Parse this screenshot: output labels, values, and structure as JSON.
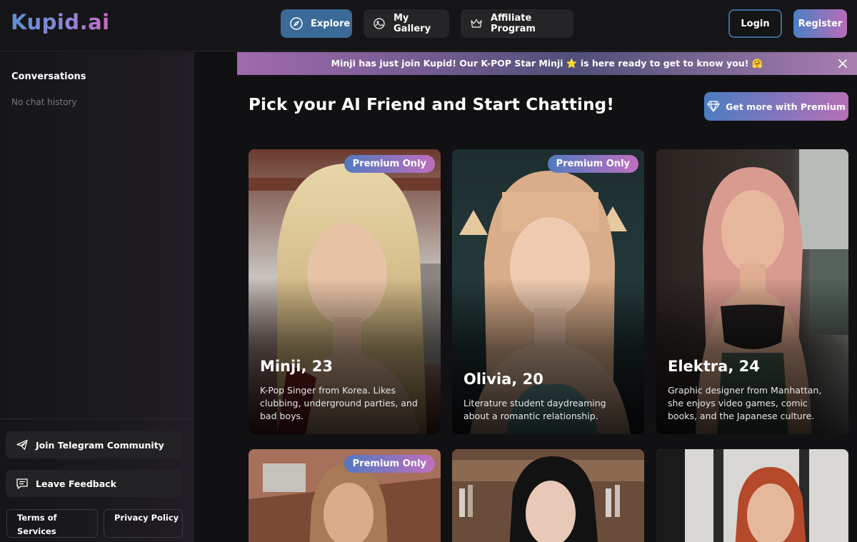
{
  "header": {
    "logo": "Kupid.ai",
    "nav": [
      {
        "label": "Explore",
        "icon": "compass-icon",
        "active": true
      },
      {
        "label": "My Gallery",
        "icon": "gallery-icon",
        "active": false
      },
      {
        "label": "Affiliate Program",
        "icon": "crown-icon",
        "active": false
      }
    ],
    "login_label": "Login",
    "register_label": "Register"
  },
  "sidebar": {
    "conversations_title": "Conversations",
    "empty_text": "No chat history",
    "telegram_label": "Join Telegram Community",
    "feedback_label": "Leave Feedback",
    "terms_label": "Terms of Services",
    "privacy_label": "Privacy Policy"
  },
  "announcement": {
    "text": "Minji has just join Kupid! Our K-POP Star Minji ⭐ is here ready to get to know you! 🤗"
  },
  "main": {
    "heading": "Pick your AI Friend and Start Chatting!",
    "premium_button": "Get more with Premium",
    "cards": [
      {
        "name": "Minji, 23",
        "description": "K-Pop Singer from Korea. Likes clubbing, underground parties, and bad boys.",
        "badge": "Premium Only"
      },
      {
        "name": "Olivia, 20",
        "description": "Literature student daydreaming about a romantic relationship.",
        "badge": "Premium Only"
      },
      {
        "name": "Elektra, 24",
        "description": "Graphic designer from Manhattan, she enjoys video games, comic books, and the Japanese culture.",
        "badge": ""
      },
      {
        "name": "",
        "description": "",
        "badge": "Premium Only"
      },
      {
        "name": "",
        "description": "",
        "badge": ""
      },
      {
        "name": "",
        "description": "",
        "badge": ""
      }
    ]
  },
  "colors": {
    "background": "#111113",
    "accent_blue": "#3b6a98",
    "gradient_start": "#4c7dc2",
    "gradient_end": "#b66fb6"
  }
}
